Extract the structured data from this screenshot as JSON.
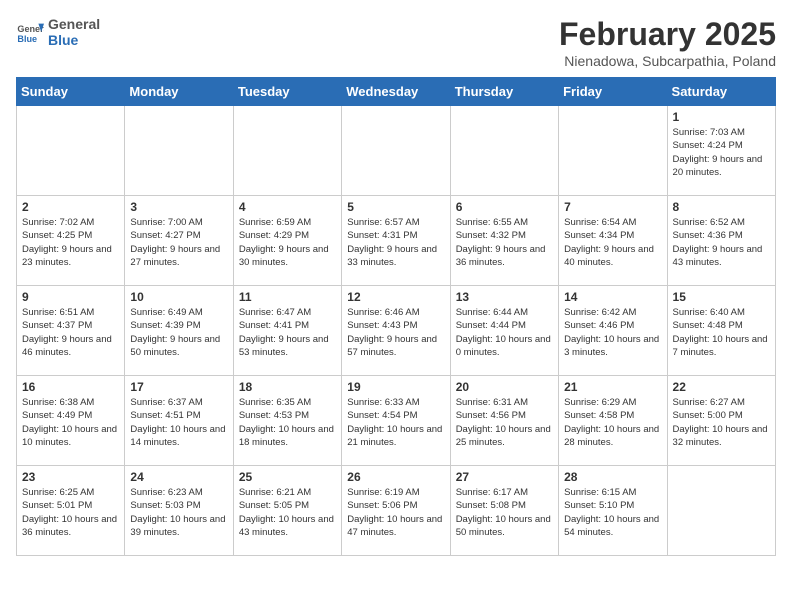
{
  "header": {
    "logo_general": "General",
    "logo_blue": "Blue",
    "month_year": "February 2025",
    "location": "Nienadowa, Subcarpathia, Poland"
  },
  "days_of_week": [
    "Sunday",
    "Monday",
    "Tuesday",
    "Wednesday",
    "Thursday",
    "Friday",
    "Saturday"
  ],
  "weeks": [
    [
      {
        "day": "",
        "info": ""
      },
      {
        "day": "",
        "info": ""
      },
      {
        "day": "",
        "info": ""
      },
      {
        "day": "",
        "info": ""
      },
      {
        "day": "",
        "info": ""
      },
      {
        "day": "",
        "info": ""
      },
      {
        "day": "1",
        "info": "Sunrise: 7:03 AM\nSunset: 4:24 PM\nDaylight: 9 hours and 20 minutes."
      }
    ],
    [
      {
        "day": "2",
        "info": "Sunrise: 7:02 AM\nSunset: 4:25 PM\nDaylight: 9 hours and 23 minutes."
      },
      {
        "day": "3",
        "info": "Sunrise: 7:00 AM\nSunset: 4:27 PM\nDaylight: 9 hours and 27 minutes."
      },
      {
        "day": "4",
        "info": "Sunrise: 6:59 AM\nSunset: 4:29 PM\nDaylight: 9 hours and 30 minutes."
      },
      {
        "day": "5",
        "info": "Sunrise: 6:57 AM\nSunset: 4:31 PM\nDaylight: 9 hours and 33 minutes."
      },
      {
        "day": "6",
        "info": "Sunrise: 6:55 AM\nSunset: 4:32 PM\nDaylight: 9 hours and 36 minutes."
      },
      {
        "day": "7",
        "info": "Sunrise: 6:54 AM\nSunset: 4:34 PM\nDaylight: 9 hours and 40 minutes."
      },
      {
        "day": "8",
        "info": "Sunrise: 6:52 AM\nSunset: 4:36 PM\nDaylight: 9 hours and 43 minutes."
      }
    ],
    [
      {
        "day": "9",
        "info": "Sunrise: 6:51 AM\nSunset: 4:37 PM\nDaylight: 9 hours and 46 minutes."
      },
      {
        "day": "10",
        "info": "Sunrise: 6:49 AM\nSunset: 4:39 PM\nDaylight: 9 hours and 50 minutes."
      },
      {
        "day": "11",
        "info": "Sunrise: 6:47 AM\nSunset: 4:41 PM\nDaylight: 9 hours and 53 minutes."
      },
      {
        "day": "12",
        "info": "Sunrise: 6:46 AM\nSunset: 4:43 PM\nDaylight: 9 hours and 57 minutes."
      },
      {
        "day": "13",
        "info": "Sunrise: 6:44 AM\nSunset: 4:44 PM\nDaylight: 10 hours and 0 minutes."
      },
      {
        "day": "14",
        "info": "Sunrise: 6:42 AM\nSunset: 4:46 PM\nDaylight: 10 hours and 3 minutes."
      },
      {
        "day": "15",
        "info": "Sunrise: 6:40 AM\nSunset: 4:48 PM\nDaylight: 10 hours and 7 minutes."
      }
    ],
    [
      {
        "day": "16",
        "info": "Sunrise: 6:38 AM\nSunset: 4:49 PM\nDaylight: 10 hours and 10 minutes."
      },
      {
        "day": "17",
        "info": "Sunrise: 6:37 AM\nSunset: 4:51 PM\nDaylight: 10 hours and 14 minutes."
      },
      {
        "day": "18",
        "info": "Sunrise: 6:35 AM\nSunset: 4:53 PM\nDaylight: 10 hours and 18 minutes."
      },
      {
        "day": "19",
        "info": "Sunrise: 6:33 AM\nSunset: 4:54 PM\nDaylight: 10 hours and 21 minutes."
      },
      {
        "day": "20",
        "info": "Sunrise: 6:31 AM\nSunset: 4:56 PM\nDaylight: 10 hours and 25 minutes."
      },
      {
        "day": "21",
        "info": "Sunrise: 6:29 AM\nSunset: 4:58 PM\nDaylight: 10 hours and 28 minutes."
      },
      {
        "day": "22",
        "info": "Sunrise: 6:27 AM\nSunset: 5:00 PM\nDaylight: 10 hours and 32 minutes."
      }
    ],
    [
      {
        "day": "23",
        "info": "Sunrise: 6:25 AM\nSunset: 5:01 PM\nDaylight: 10 hours and 36 minutes."
      },
      {
        "day": "24",
        "info": "Sunrise: 6:23 AM\nSunset: 5:03 PM\nDaylight: 10 hours and 39 minutes."
      },
      {
        "day": "25",
        "info": "Sunrise: 6:21 AM\nSunset: 5:05 PM\nDaylight: 10 hours and 43 minutes."
      },
      {
        "day": "26",
        "info": "Sunrise: 6:19 AM\nSunset: 5:06 PM\nDaylight: 10 hours and 47 minutes."
      },
      {
        "day": "27",
        "info": "Sunrise: 6:17 AM\nSunset: 5:08 PM\nDaylight: 10 hours and 50 minutes."
      },
      {
        "day": "28",
        "info": "Sunrise: 6:15 AM\nSunset: 5:10 PM\nDaylight: 10 hours and 54 minutes."
      },
      {
        "day": "",
        "info": ""
      }
    ]
  ]
}
